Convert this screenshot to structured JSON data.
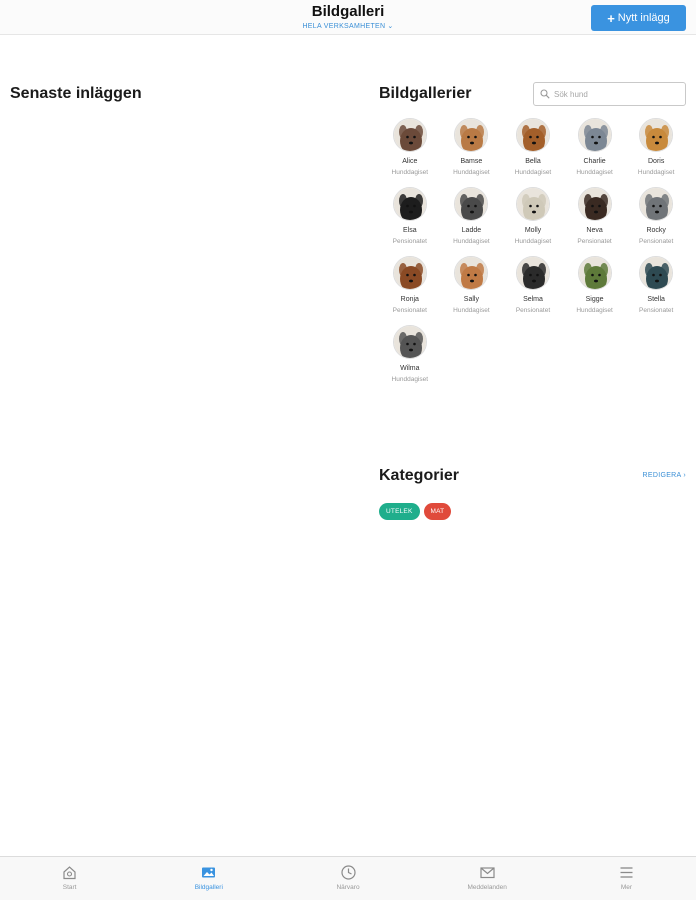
{
  "header": {
    "title": "Bildgalleri",
    "subtitle": "HELA VERKSAMHETEN",
    "new_post_label": "Nytt inlägg"
  },
  "left": {
    "title": "Senaste inläggen"
  },
  "galleries": {
    "title": "Bildgallerier",
    "search_placeholder": "Sök hund",
    "dogs": [
      {
        "name": "Alice",
        "place": "Hunddagiset",
        "color": "#6b4a3a"
      },
      {
        "name": "Bamse",
        "place": "Hunddagiset",
        "color": "#b97a45"
      },
      {
        "name": "Bella",
        "place": "Hunddagiset",
        "color": "#a35f2a"
      },
      {
        "name": "Charlie",
        "place": "Hunddagiset",
        "color": "#7c8794"
      },
      {
        "name": "Doris",
        "place": "Hunddagiset",
        "color": "#c88a3c"
      },
      {
        "name": "Elsa",
        "place": "Pensionatet",
        "color": "#1d1d1d"
      },
      {
        "name": "Ladde",
        "place": "Hunddagiset",
        "color": "#4a4a4a"
      },
      {
        "name": "Molly",
        "place": "Hunddagiset",
        "color": "#cfc9b8"
      },
      {
        "name": "Neva",
        "place": "Pensionatet",
        "color": "#3a2a22"
      },
      {
        "name": "Rocky",
        "place": "Pensionatet",
        "color": "#707478"
      },
      {
        "name": "Ronja",
        "place": "Pensionatet",
        "color": "#8a4a25"
      },
      {
        "name": "Sally",
        "place": "Hunddagiset",
        "color": "#c07a45"
      },
      {
        "name": "Selma",
        "place": "Pensionatet",
        "color": "#2b2b2b"
      },
      {
        "name": "Sigge",
        "place": "Hunddagiset",
        "color": "#5e7a3a"
      },
      {
        "name": "Stella",
        "place": "Pensionatet",
        "color": "#2e4a52"
      },
      {
        "name": "Wilma",
        "place": "Hunddagiset",
        "color": "#555555"
      }
    ]
  },
  "categories": {
    "title": "Kategorier",
    "edit_label": "REDIGERA",
    "tags": [
      {
        "label": "UTELEK",
        "color": "#1fae8c"
      },
      {
        "label": "MAT",
        "color": "#e04a3b"
      }
    ]
  },
  "tabbar": {
    "items": [
      {
        "label": "Start",
        "icon": "home-icon",
        "active": false
      },
      {
        "label": "Bildgalleri",
        "icon": "image-icon",
        "active": true
      },
      {
        "label": "Närvaro",
        "icon": "clock-icon",
        "active": false
      },
      {
        "label": "Meddelanden",
        "icon": "mail-icon",
        "active": false
      },
      {
        "label": "Mer",
        "icon": "menu-icon",
        "active": false
      }
    ]
  }
}
